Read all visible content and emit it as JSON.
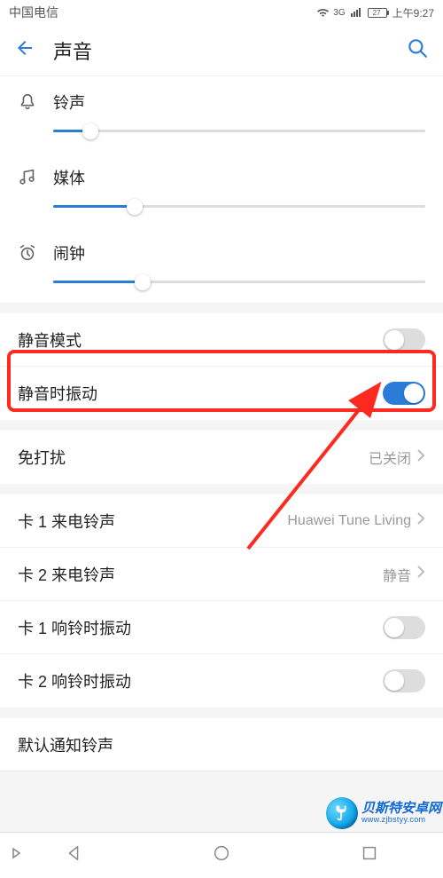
{
  "status": {
    "carrier": "中国电信",
    "net": "3G",
    "battery": "27",
    "time": "上午9:27"
  },
  "header": {
    "title": "声音"
  },
  "sliders": {
    "ring": {
      "label": "铃声",
      "percent": 10
    },
    "media": {
      "label": "媒体",
      "percent": 22
    },
    "alarm": {
      "label": "闹钟",
      "percent": 24
    }
  },
  "settings": {
    "silent": {
      "label": "静音模式",
      "on": false
    },
    "vibrate": {
      "label": "静音时振动",
      "on": true
    },
    "dnd": {
      "label": "免打扰",
      "value": "已关闭"
    },
    "sim1ring": {
      "label": "卡 1 来电铃声",
      "value": "Huawei Tune Living"
    },
    "sim2ring": {
      "label": "卡 2 来电铃声",
      "value": "静音"
    },
    "sim1vib": {
      "label": "卡 1 响铃时振动",
      "on": false
    },
    "sim2vib": {
      "label": "卡 2 响铃时振动",
      "on": false
    },
    "notify": {
      "label": "默认通知铃声"
    }
  },
  "watermark": {
    "cn": "贝斯特安卓网",
    "url": "www.zjbstyy.com"
  }
}
